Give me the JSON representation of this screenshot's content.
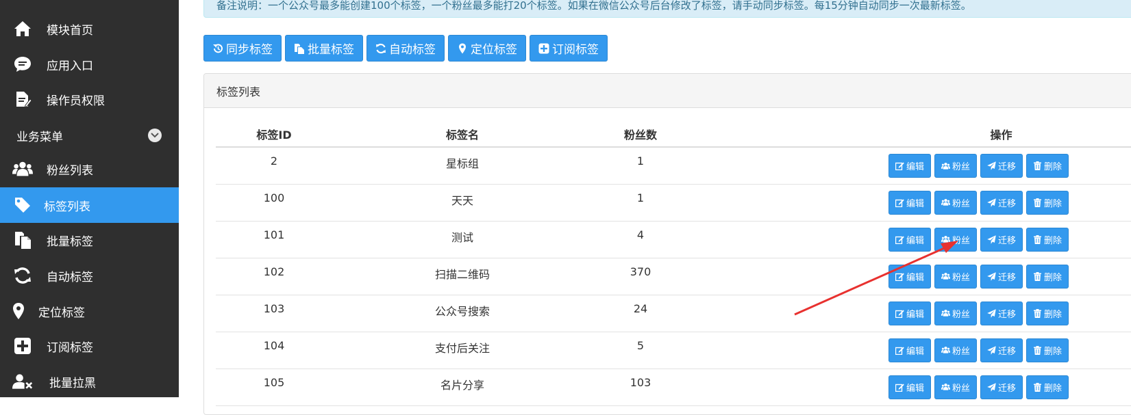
{
  "sidebar": {
    "items_top": [
      {
        "label": "模块首页",
        "icon": "home-icon"
      },
      {
        "label": "应用入口",
        "icon": "chat-icon"
      },
      {
        "label": "操作员权限",
        "icon": "edit-doc-icon"
      }
    ],
    "section_label": "业务菜单",
    "items_business": [
      {
        "label": "粉丝列表",
        "icon": "users-icon"
      },
      {
        "label": "标签列表",
        "icon": "tag-icon"
      },
      {
        "label": "批量标签",
        "icon": "copy-icon"
      },
      {
        "label": "自动标签",
        "icon": "refresh-icon"
      },
      {
        "label": "定位标签",
        "icon": "map-marker-icon"
      },
      {
        "label": "订阅标签",
        "icon": "plus-square-icon"
      },
      {
        "label": "批量拉黑",
        "icon": "user-times-icon"
      }
    ],
    "active_item": "标签列表"
  },
  "notice": {
    "text": "备注说明：一个公众号最多能创建100个标签，一个粉丝最多能打20个标签。如果在微信公众号后台修改了标签，请手动同步标签。每15分钟自动同步一次最新标签。"
  },
  "toolbar": {
    "buttons": [
      {
        "label": "同步标签",
        "icon": "history-icon"
      },
      {
        "label": "批量标签",
        "icon": "copy-icon"
      },
      {
        "label": "自动标签",
        "icon": "refresh-icon"
      },
      {
        "label": "定位标签",
        "icon": "map-marker-icon"
      },
      {
        "label": "订阅标签",
        "icon": "plus-square-icon"
      }
    ]
  },
  "panel": {
    "title": "标签列表",
    "columns": [
      "标签ID",
      "标签名",
      "粉丝数",
      "操作"
    ],
    "row_actions": [
      {
        "label": "编辑",
        "icon": "edit-icon"
      },
      {
        "label": "粉丝",
        "icon": "users-icon"
      },
      {
        "label": "迁移",
        "icon": "send-icon"
      },
      {
        "label": "删除",
        "icon": "trash-icon"
      }
    ],
    "rows": [
      {
        "id": "2",
        "name": "星标组",
        "fans": "1"
      },
      {
        "id": "100",
        "name": "天天",
        "fans": "1"
      },
      {
        "id": "101",
        "name": "测试",
        "fans": "4"
      },
      {
        "id": "102",
        "name": "扫描二维码",
        "fans": "370"
      },
      {
        "id": "103",
        "name": "公众号搜索",
        "fans": "24"
      },
      {
        "id": "104",
        "name": "支付后关注",
        "fans": "5"
      },
      {
        "id": "105",
        "name": "名片分享",
        "fans": "103"
      }
    ]
  },
  "colors": {
    "sidebar_bg": "#2f2f2f",
    "accent": "#3399ee",
    "annotation_arrow": "#e8312f"
  }
}
